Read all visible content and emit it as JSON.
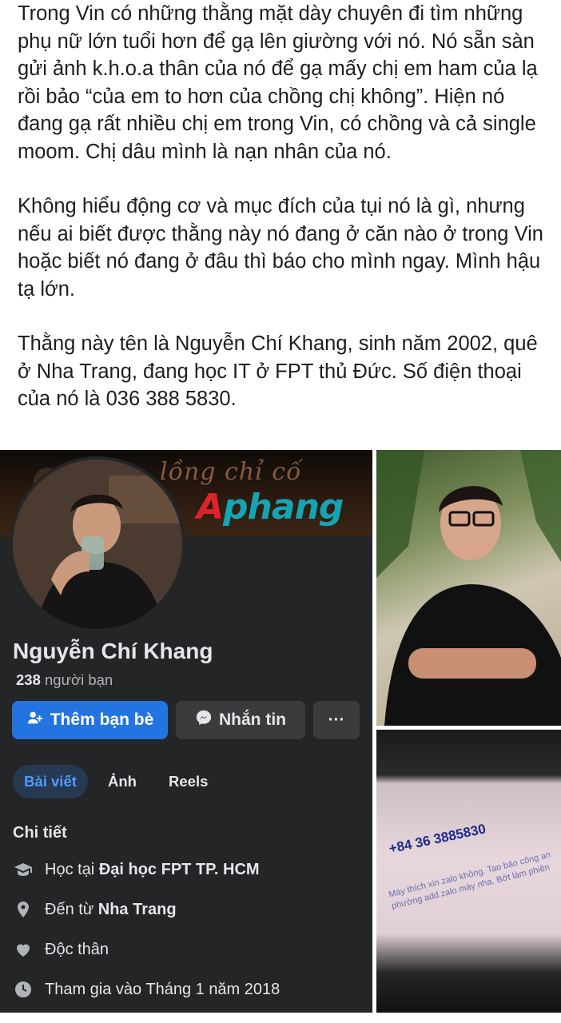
{
  "post": {
    "paragraphs": [
      "Trong Vin có những thằng mặt dày chuyên đi tìm những phụ nữ lớn tuổi hơn để gạ lên giường với nó. Nó sẵn sàn gửi ảnh k.h.o.a thân của nó để gạ mấy chị em ham của lạ rồi bảo “của em to hơn của chồng chị không”. Hiện nó đang gạ rất nhiều chị em trong Vin, có chồng và cả single moom. Chị dâu mình là nạn nhân của nó.",
      "Không hiểu động cơ và mục đích của tụi nó là gì, nhưng nếu ai biết được thằng này nó đang ở căn nào ở trong Vin hoặc biết nó đang ở đâu thì báo cho mình ngay. Mình hậu tạ lớn.",
      "Thằng này tên là Nguyễn Chí Khang, sinh năm 2002, quê ở Nha Trang, đang học IT ở FPT thủ Đức. Số điện thoại của nó là 036 388 5830."
    ]
  },
  "profile": {
    "cover_script": "lồng chỉ cố",
    "watermark_a": "A",
    "watermark_b": "phang",
    "name": "Nguyễn Chí Khang",
    "friends_count": "238",
    "friends_label": "người bạn",
    "add_friend_label": "Thêm bạn bè",
    "message_label": "Nhắn tin",
    "more_label": "···",
    "tabs": [
      "Bài viết",
      "Ảnh",
      "Reels"
    ],
    "details_title": "Chi tiết",
    "details": {
      "study_prefix": "Học tại",
      "study_value": "Đại học FPT TP. HCM",
      "from_prefix": "Đến từ",
      "from_value": "Nha Trang",
      "status": "Độc thân",
      "joined": "Tham gia vào Tháng 1 năm 2018"
    }
  },
  "photos": {
    "paper_phone": "+84 36 3885830",
    "paper_note": "Mày thích xin zalo không. Tao bảo công an phường add zalo mày nha. Bớt làm phiền"
  },
  "colors": {
    "dark_bg": "#242526",
    "primary_button": "#2374e1",
    "secondary_button": "#3a3b3c",
    "active_tab_text": "#4e9bff",
    "watermark_red": "#e0222c",
    "watermark_teal": "#16a3b4"
  },
  "icons": {
    "add_friend": "person-plus-icon",
    "message": "messenger-icon",
    "study": "graduation-cap-icon",
    "from": "location-pin-icon",
    "status": "heart-icon",
    "joined": "clock-icon"
  }
}
